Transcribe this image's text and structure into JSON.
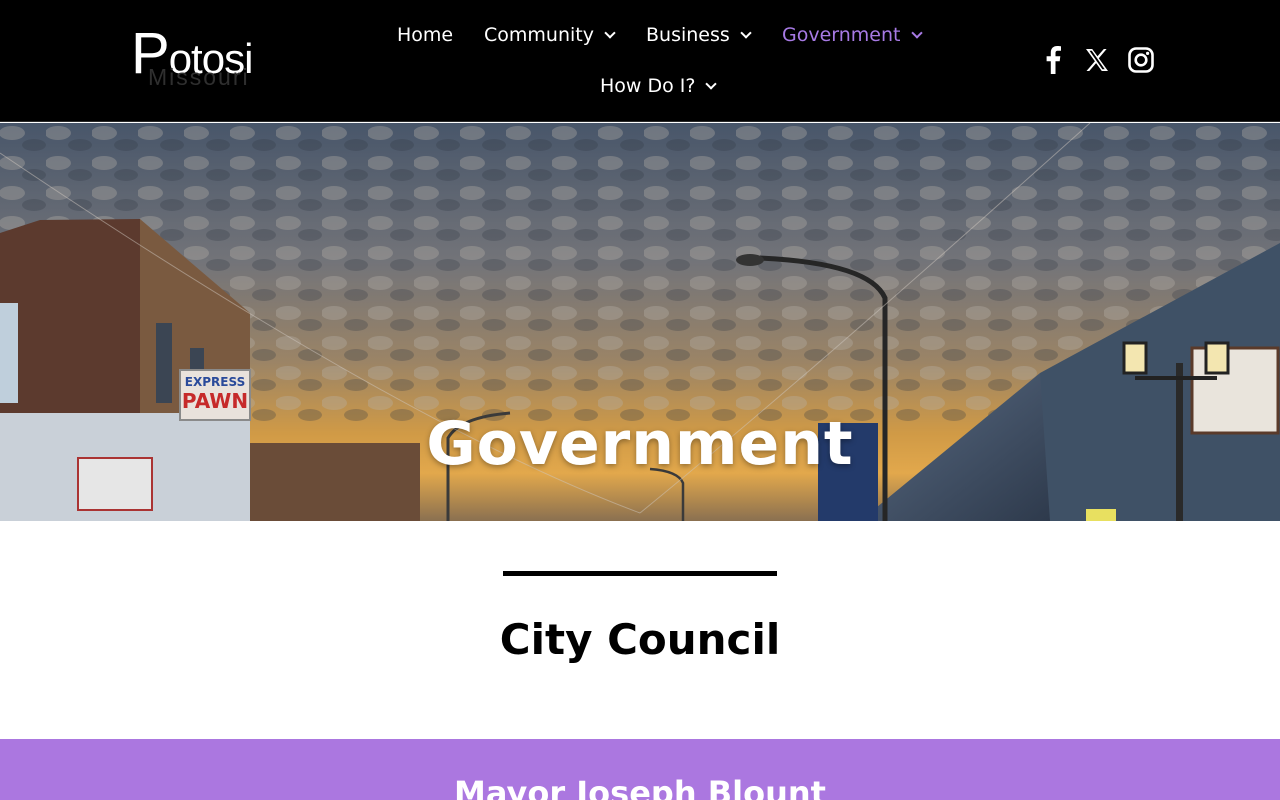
{
  "header": {
    "logo_text": "Potosi",
    "logo_subtext": "Missouri"
  },
  "nav": {
    "items": [
      {
        "label": "Home",
        "has_dropdown": false,
        "active": false
      },
      {
        "label": "Community",
        "has_dropdown": true,
        "active": false
      },
      {
        "label": "Business",
        "has_dropdown": true,
        "active": false
      },
      {
        "label": "Government",
        "has_dropdown": true,
        "active": true
      },
      {
        "label": "How Do I?",
        "has_dropdown": true,
        "active": false
      }
    ]
  },
  "social": [
    {
      "icon": "facebook-icon"
    },
    {
      "icon": "x-twitter-icon"
    },
    {
      "icon": "instagram-icon"
    }
  ],
  "hero": {
    "title": "Government",
    "storefront_sign_line1": "EXPRESS",
    "storefront_sign_line2": "PAWN"
  },
  "section": {
    "title": "City Council"
  },
  "band": {
    "title": "Mayor Joseph Blount"
  },
  "colors": {
    "header_bg": "#000000",
    "accent": "#a77ae4",
    "band_bg": "#ab77e0"
  }
}
